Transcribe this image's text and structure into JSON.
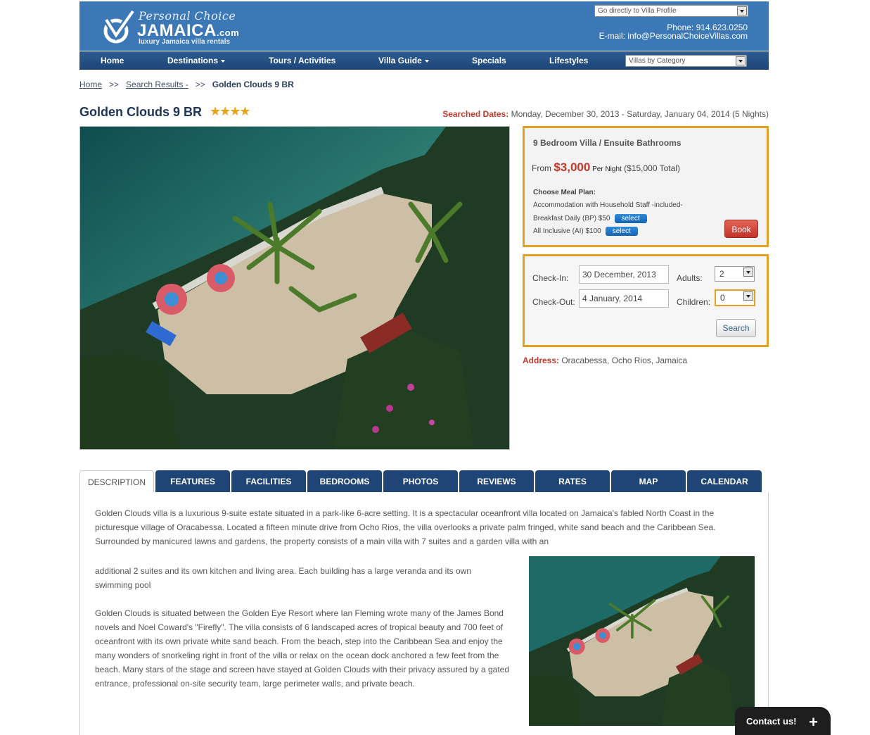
{
  "header": {
    "logo_script": "Personal Choice",
    "logo_main": "JAMAICA",
    "logo_dotcom": ".com",
    "logo_tagline": "luxury Jamaica villa rentals",
    "villa_select_placeholder": "Go directly to Villa Profile",
    "phone": "Phone: 914.623.0250",
    "email": "E-mail: info@PersonalChoiceVillas.com"
  },
  "nav": {
    "items": [
      {
        "label": "Home"
      },
      {
        "label": "Destinations"
      },
      {
        "label": "Tours / Activities"
      },
      {
        "label": "Villa Guide"
      },
      {
        "label": "Specials"
      },
      {
        "label": "Lifestyles"
      }
    ],
    "category_select": "Villas by Category"
  },
  "breadcrumb": {
    "home": "Home",
    "sep1": ">>",
    "search": "Search Results -",
    "sep2": ">>",
    "current": "Golden Clouds 9 BR"
  },
  "villa": {
    "title": "Golden Clouds 9 BR",
    "stars": "★★★★",
    "star_rating": 4,
    "searched_label": "Searched Dates:",
    "searched_value": " Monday, December 30, 2013 - Saturday, January 04, 2014 (5 Nights)"
  },
  "booking": {
    "room_type": "9 Bedroom Villa / Ensuite Bathrooms",
    "from": "From ",
    "price": "$3,000",
    "per_night": " Per Night",
    "total": " ($15,000 Total)",
    "meal_heading": "Choose Meal Plan:",
    "meal_1": "Accommodation with Household Staff  -included-",
    "meal_2": "Breakfast Daily (BP) $50",
    "meal_3": "All Inclusive (AI) $100",
    "select_label": "select",
    "book_label": "Book"
  },
  "search": {
    "checkin_label": "Check-In:",
    "checkin_value": "30 December, 2013",
    "checkout_label": "Check-Out:",
    "checkout_value": "4 January, 2014",
    "adults_label": "Adults:",
    "adults_value": "2",
    "children_label": "Children:",
    "children_value": "0",
    "search_label": "Search"
  },
  "address": {
    "label": "Address:",
    "value": " Oracabessa, Ocho Rios, Jamaica"
  },
  "tabs": [
    "DESCRIPTION",
    "FEATURES",
    "FACILITIES",
    "BEDROOMS",
    "PHOTOS",
    "REVIEWS",
    "RATES",
    "MAP",
    "CALENDAR"
  ],
  "description": {
    "p1": "Golden Clouds villa is a luxurious 9-suite estate situated in a park-like 6-acre setting. It is a spectacular oceanfront villa located on Jamaica's fabled North Coast in the picturesque village of Oracabessa. Located a fifteen minute drive from Ocho Rios, the villa overlooks a private palm fringed, white sand beach and the Caribbean Sea. Surrounded by manicured lawns and gardens, the property consists of a main villa with 7 suites and a garden villa with an",
    "p2": "additional 2 suites and its own kitchen and living area. Each building has a large veranda and its own swimming pool",
    "p3": "Golden Clouds is situated between the Golden Eye Resort where Ian Fleming wrote many of the James Bond novels and Noel Coward's \"Firefly\". The villa consists of 6 landscaped acres of tropical beauty and 700 feet of oceanfront with its own private white sand beach. From the beach, step into the Caribbean Sea and enjoy the many wonders of snorkeling right in front of the villa or relax on the ocean dock anchored a few feet from the beach. Many stars of the stage and screen have stayed at Golden Clouds with their privacy assured by a gated entrance, professional on-site security team, large perimeter walls, and private beach."
  },
  "contact_us": {
    "label": "Contact us!",
    "plus": "+"
  },
  "colors": {
    "header_blue": "#3d78b6",
    "nav_blue": "#1e4678",
    "tab_blue": "#1f4577",
    "accent_orange": "#e2a125",
    "price_red": "#c0392b",
    "book_red": "#d9453a",
    "select_blue": "#1663b4"
  },
  "icons": [
    "logo-check-icon",
    "dropdown-arrow-icon",
    "nav-caret-icon",
    "star-icon",
    "plus-icon"
  ]
}
